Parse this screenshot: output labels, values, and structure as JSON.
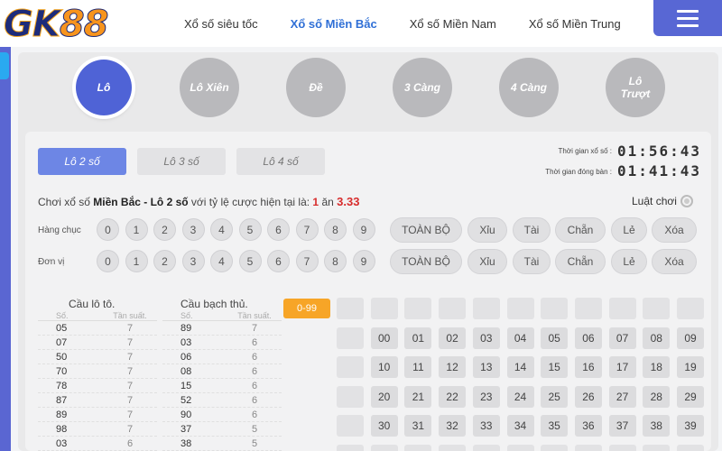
{
  "logo": {
    "gk": "GK",
    "n88": "88"
  },
  "nav": {
    "items": [
      {
        "label": "Xổ số siêu tốc",
        "active": false
      },
      {
        "label": "Xổ số Miền Bắc",
        "active": true
      },
      {
        "label": "Xổ số Miền Nam",
        "active": false
      },
      {
        "label": "Xổ số Miền Trung",
        "active": false
      }
    ],
    "menu_icon": "hamburger-icon"
  },
  "categories": [
    {
      "label": "Lô",
      "active": true
    },
    {
      "label": "Lô Xiên",
      "active": false
    },
    {
      "label": "Đề",
      "active": false
    },
    {
      "label": "3 Càng",
      "active": false
    },
    {
      "label": "4 Càng",
      "active": false
    },
    {
      "label": "Lô Trượt",
      "active": false
    }
  ],
  "subtabs": [
    {
      "label": "Lô 2 số",
      "active": true
    },
    {
      "label": "Lô 3 số",
      "active": false
    },
    {
      "label": "Lô 4 số",
      "active": false
    }
  ],
  "timers": {
    "draw_label": "Thời gian xổ số :",
    "draw_value": "01:56:43",
    "close_label": "Thời gian đóng bàn :",
    "close_value": "01:41:43"
  },
  "rate": {
    "prefix": "Chơi xổ số ",
    "region": "Miền Bắc - Lô 2 số",
    "middle": " với tỷ lệ cược hiện tại là: ",
    "one": "1",
    "an": " ăn ",
    "value": "3.33"
  },
  "rules_label": "Luật chơi",
  "rows": [
    {
      "label": "Hàng chục"
    },
    {
      "label": "Đơn vị"
    }
  ],
  "digits": [
    "0",
    "1",
    "2",
    "3",
    "4",
    "5",
    "6",
    "7",
    "8",
    "9"
  ],
  "quick_picks": [
    "TOÀN BỘ",
    "Xỉu",
    "Tài",
    "Chẵn",
    "Lẻ",
    "Xóa"
  ],
  "stats": [
    {
      "title": "Cầu lô tô.",
      "col_so": "Số.",
      "col_freq": "Tần suất.",
      "rows": [
        [
          "05",
          "7"
        ],
        [
          "07",
          "7"
        ],
        [
          "50",
          "7"
        ],
        [
          "70",
          "7"
        ],
        [
          "78",
          "7"
        ],
        [
          "87",
          "7"
        ],
        [
          "89",
          "7"
        ],
        [
          "98",
          "7"
        ],
        [
          "03",
          "6"
        ]
      ]
    },
    {
      "title": "Cầu bạch thủ.",
      "col_so": "Số.",
      "col_freq": "Tần suất.",
      "rows": [
        [
          "89",
          "7"
        ],
        [
          "03",
          "6"
        ],
        [
          "06",
          "6"
        ],
        [
          "08",
          "6"
        ],
        [
          "15",
          "6"
        ],
        [
          "52",
          "6"
        ],
        [
          "90",
          "6"
        ],
        [
          "37",
          "5"
        ],
        [
          "38",
          "5"
        ]
      ]
    }
  ],
  "range_button": "0-99",
  "number_grid": [
    [
      "00",
      "01",
      "02",
      "03",
      "04",
      "05",
      "06",
      "07",
      "08",
      "09"
    ],
    [
      "10",
      "11",
      "12",
      "13",
      "14",
      "15",
      "16",
      "17",
      "18",
      "19"
    ],
    [
      "20",
      "21",
      "22",
      "23",
      "24",
      "25",
      "26",
      "27",
      "28",
      "29"
    ],
    [
      "30",
      "31",
      "32",
      "33",
      "34",
      "35",
      "36",
      "37",
      "38",
      "39"
    ]
  ]
}
